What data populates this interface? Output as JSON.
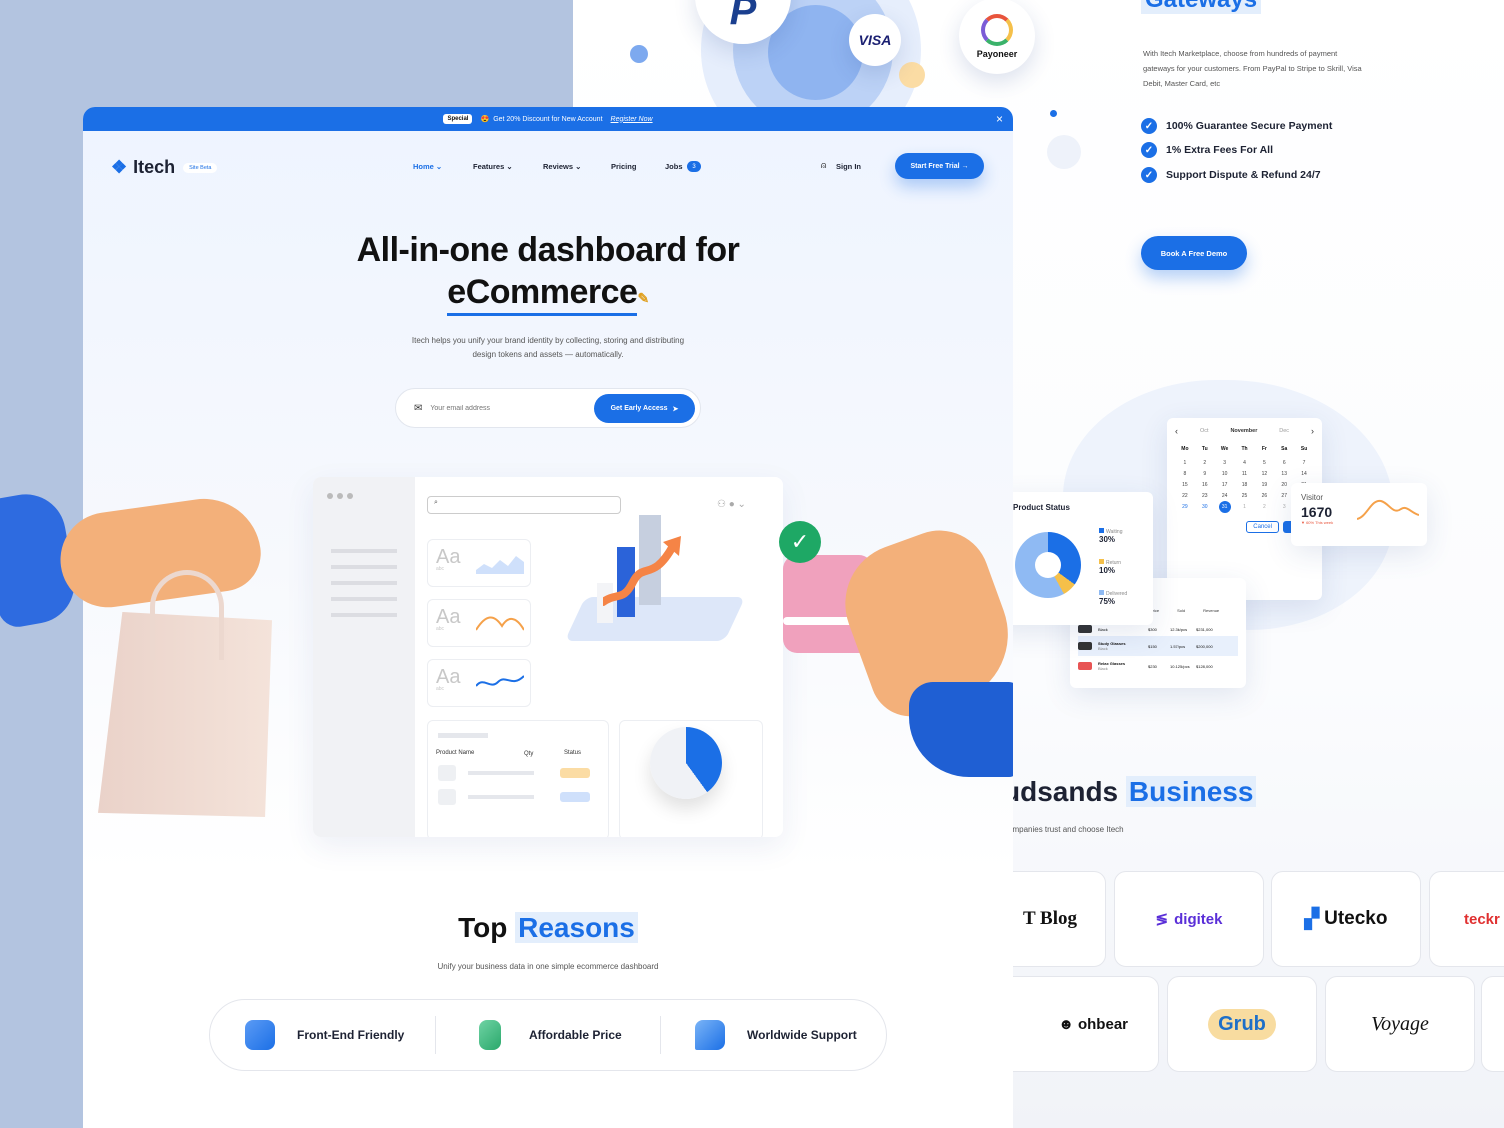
{
  "right_page": {
    "payment_logos": [
      "VISA",
      "Payoneer"
    ],
    "gateways": {
      "title": "Gateways",
      "description": "With Itech Marketplace, choose from hundreds of payment gateways for your customers. From PayPal to Stripe to Skrill, Visa Debit, Master Card, etc",
      "features": [
        "100% Guarantee Secure Payment",
        "1% Extra Fees For All",
        "Support Dispute & Refund 24/7"
      ],
      "cta": "Book A Free Demo"
    },
    "calendar": {
      "prev_month": "Oct",
      "month": "November",
      "next_month": "Dec",
      "weekdays": [
        "Mo",
        "Tu",
        "We",
        "Th",
        "Fr",
        "Sa",
        "Su"
      ],
      "days": [
        "1",
        "2",
        "3",
        "4",
        "5",
        "6",
        "7",
        "8",
        "9",
        "10",
        "11",
        "12",
        "13",
        "14",
        "15",
        "16",
        "17",
        "18",
        "19",
        "20",
        "21",
        "22",
        "23",
        "24",
        "25",
        "26",
        "27",
        "28",
        "29",
        "30",
        "31",
        "1",
        "2",
        "3",
        "4"
      ],
      "selected": "31",
      "cancel": "Cancel",
      "apply": "Apply"
    },
    "visitor": {
      "label": "Visitor",
      "value": "1670",
      "change": "▼ 60% This week"
    },
    "product_status": {
      "title": "Product Status",
      "items": [
        {
          "label": "Waiting",
          "value": "30%",
          "color": "#1b6fe6"
        },
        {
          "label": "Return",
          "value": "10%",
          "color": "#f5c04a"
        },
        {
          "label": "Delivered",
          "value": "75%",
          "color": "#8fbaf3"
        }
      ]
    },
    "orders": {
      "headers": [
        "Price",
        "Sold",
        "Revenue"
      ],
      "rows": [
        {
          "name": "",
          "sub": "Black",
          "price": "$300",
          "sold": "12.3k/pcs",
          "rev": "$231,000"
        },
        {
          "name": "Study Glasses",
          "sub": "Black",
          "price": "$150",
          "sold": "1.57/pcs",
          "rev": "$200,000"
        },
        {
          "name": "Relax Glasses",
          "sub": "Black",
          "price": "$230",
          "sold": "10.125/pcs",
          "rev": "$128,000"
        }
      ]
    },
    "business": {
      "title_a": "udsands",
      "title_b": "Business",
      "subtitle": "ompanies trust and choose Itech"
    },
    "brands_row1": [
      "T Blog",
      "digitek",
      "Utecko",
      "teckr"
    ],
    "brands_row2": [
      "ohbear",
      "Grub",
      "Voyage"
    ]
  },
  "main": {
    "topbar": {
      "badge": "Special",
      "text": "Get 20% Discount for New Account",
      "link": "Register Now",
      "close": "×"
    },
    "brand": {
      "name": "Itech",
      "badge": "Site Beta"
    },
    "nav": [
      {
        "label": "Home ⌄"
      },
      {
        "label": "Features ⌄"
      },
      {
        "label": "Reviews ⌄"
      },
      {
        "label": "Pricing"
      },
      {
        "label": "Jobs"
      }
    ],
    "jobs_count": "3",
    "signin": "Sign In",
    "trial": "Start Free Trial  →",
    "hero": {
      "line1": "All-in-one dashboard for",
      "line2": "eCommerce",
      "subtitle_1": "Itech helps you unify your brand identity by collecting, storing and distributing",
      "subtitle_2": "design tokens and assets — automatically."
    },
    "signup": {
      "placeholder": "Your email address",
      "button": "Get Early Access"
    },
    "dash": {
      "aa": [
        "Aa",
        "Aa",
        "Aa"
      ],
      "abc": [
        "abc",
        "abc",
        "abc"
      ],
      "table_headers": [
        "Product Name",
        "Qty",
        "Status"
      ]
    },
    "reasons": {
      "title_a": "Top",
      "title_b": "Reasons",
      "subtitle": "Unify your business data in one simple ecommerce dashboard",
      "items": [
        "Front-End Friendly",
        "Affordable Price",
        "Worldwide Support"
      ]
    }
  }
}
